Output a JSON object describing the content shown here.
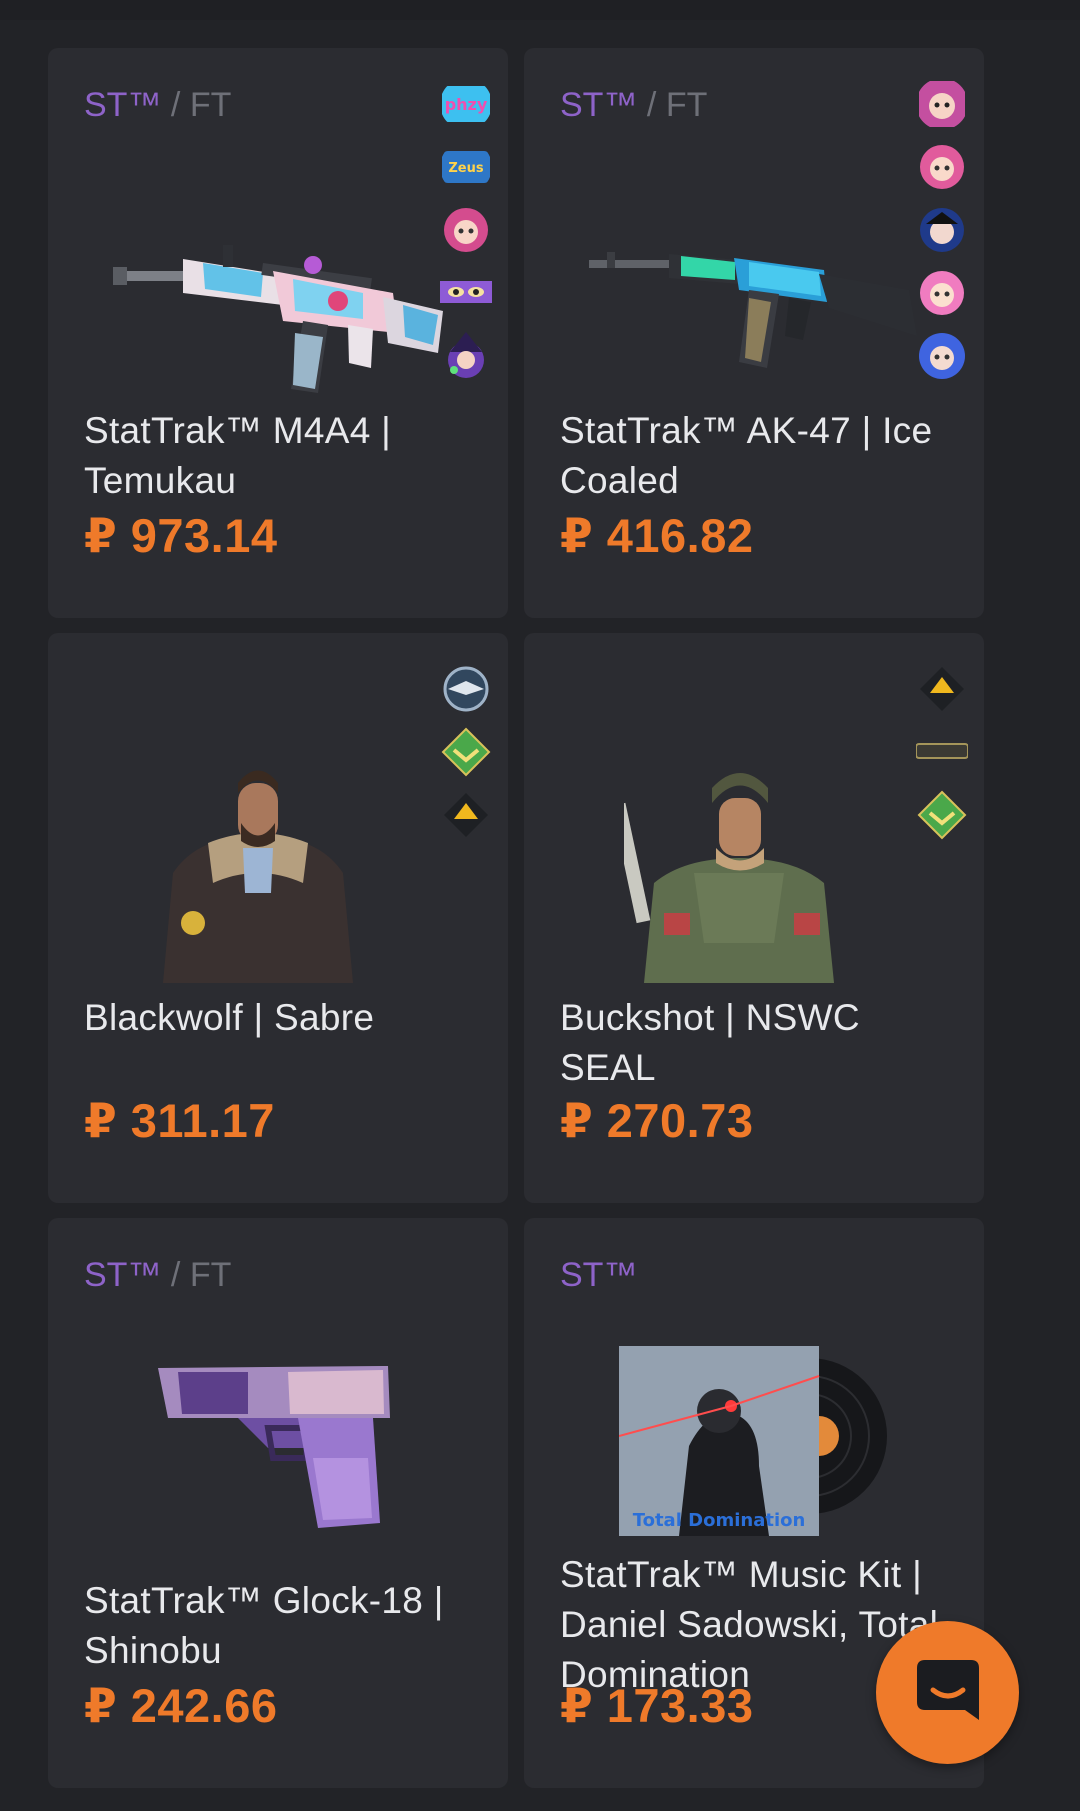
{
  "items": [
    {
      "quality_st": "ST™",
      "quality_sep": "/",
      "quality_wear": "FT",
      "name": "StatTrak™ M4A4 | Temukau",
      "price": "₽ 973.14",
      "stickers": [
        "phzy-sticker-icon",
        "zeus-sticker-icon",
        "anime-girl-sticker-icon",
        "eyes-sticker-icon",
        "witch-sticker-icon"
      ]
    },
    {
      "quality_st": "ST™",
      "quality_sep": "/",
      "quality_wear": "FT",
      "name": "StatTrak™ AK-47 | Ice Coaled",
      "price": "₽ 416.82",
      "stickers": [
        "pink-girl-sticker-icon",
        "heart-girl-sticker-icon",
        "dark-girl-sticker-icon",
        "bubble-girl-sticker-icon",
        "blue-girl-sticker-icon"
      ]
    },
    {
      "name": "Blackwolf | Sabre",
      "price": "₽ 311.17",
      "stickers": [
        "eagle-patch-icon",
        "green-chevron-patch-icon",
        "yellow-arrow-patch-icon"
      ]
    },
    {
      "name": "Buckshot | NSWC SEAL",
      "price": "₽ 270.73",
      "stickers": [
        "yellow-arrow-patch-icon",
        "bar-patch-icon",
        "green-chevron-patch-icon"
      ]
    },
    {
      "quality_st": "ST™",
      "quality_sep": "/",
      "quality_wear": "FT",
      "name": "StatTrak™ Glock-18 | Shinobu",
      "price": "₽ 242.66"
    },
    {
      "quality_st": "ST™",
      "name": "StatTrak™ Music Kit | Daniel Sadowski, Total Domination",
      "price": "₽ 173.33",
      "album_text": "Total Domination"
    }
  ],
  "colors": {
    "background": "#222327",
    "card": "#2b2c31",
    "price": "#ef7a2a",
    "stattrak": "#8e63c9",
    "chat_button": "#ef7a2a"
  }
}
